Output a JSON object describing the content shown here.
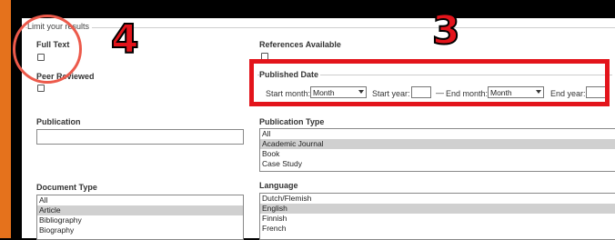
{
  "legend": "Limit your results",
  "full_text": {
    "label": "Full Text"
  },
  "peer_reviewed": {
    "label": "Peer Reviewed"
  },
  "references": {
    "label": "References Available"
  },
  "published_date": {
    "label": "Published Date",
    "start_month_label": "Start month:",
    "start_month_value": "Month",
    "start_year_label": "Start year:",
    "dash": "—",
    "end_month_label": "End month:",
    "end_month_value": "Month",
    "end_year_label": "End year:"
  },
  "publication": {
    "label": "Publication"
  },
  "publication_type": {
    "label": "Publication Type",
    "options": [
      "All",
      "Academic Journal",
      "Book",
      "Case Study"
    ],
    "selected": "Academic Journal"
  },
  "document_type": {
    "label": "Document Type",
    "options": [
      "All",
      "Article",
      "Bibliography",
      "Biography"
    ],
    "selected": "Article"
  },
  "language": {
    "label": "Language",
    "options": [
      "Dutch/Flemish",
      "English",
      "Finnish",
      "French"
    ],
    "selected": "English"
  },
  "annotations": {
    "step4": "4",
    "step3": "3"
  },
  "colors": {
    "highlight": "#e3141b",
    "circle": "#ec5a4b",
    "side_accent": "#e5721c"
  }
}
